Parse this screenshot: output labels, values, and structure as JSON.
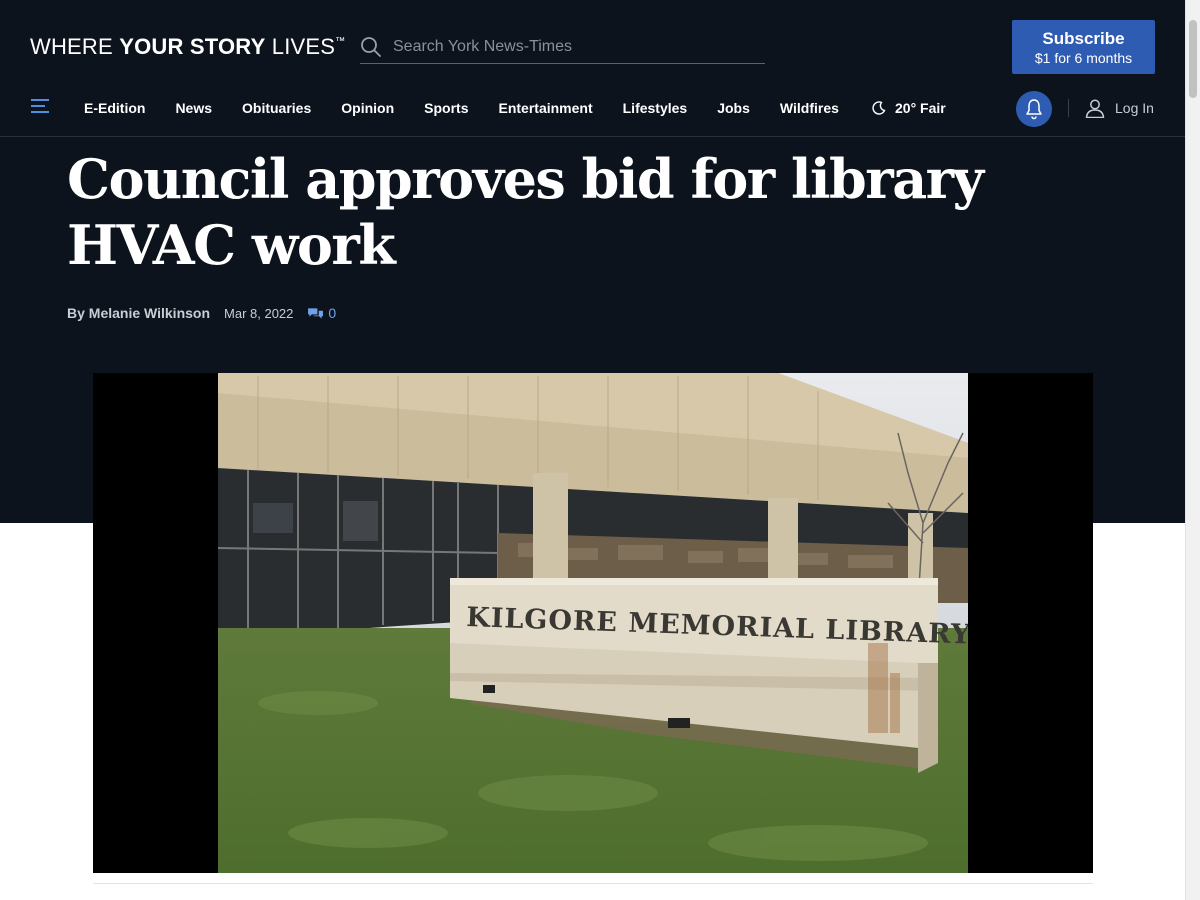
{
  "header": {
    "tagline_thin1": "WHERE ",
    "tagline_bold": "YOUR STORY",
    "tagline_thin2": " LIVES",
    "tagline_tm": "™",
    "search_placeholder": "Search York News-Times",
    "subscribe_line1": "Subscribe",
    "subscribe_line2": "$1 for 6 months"
  },
  "nav": {
    "items": [
      "E-Edition",
      "News",
      "Obituaries",
      "Opinion",
      "Sports",
      "Entertainment",
      "Lifestyles",
      "Jobs",
      "Wildfires"
    ],
    "weather": "20° Fair",
    "login": "Log In"
  },
  "article": {
    "headline": "Council approves bid for library HVAC work",
    "author": "By Melanie Wilkinson",
    "date": "Mar 8, 2022",
    "comment_count": "0",
    "photo_sign_text": "KILGORE MEMORIAL LIBRARY"
  },
  "colors": {
    "header_bg": "#0d131c",
    "accent_blue": "#2f5cb3",
    "link_blue": "#6ea3ec"
  },
  "icons": [
    "search-icon",
    "menu-icon",
    "moon-icon",
    "bell-icon",
    "user-icon",
    "comments-icon"
  ]
}
